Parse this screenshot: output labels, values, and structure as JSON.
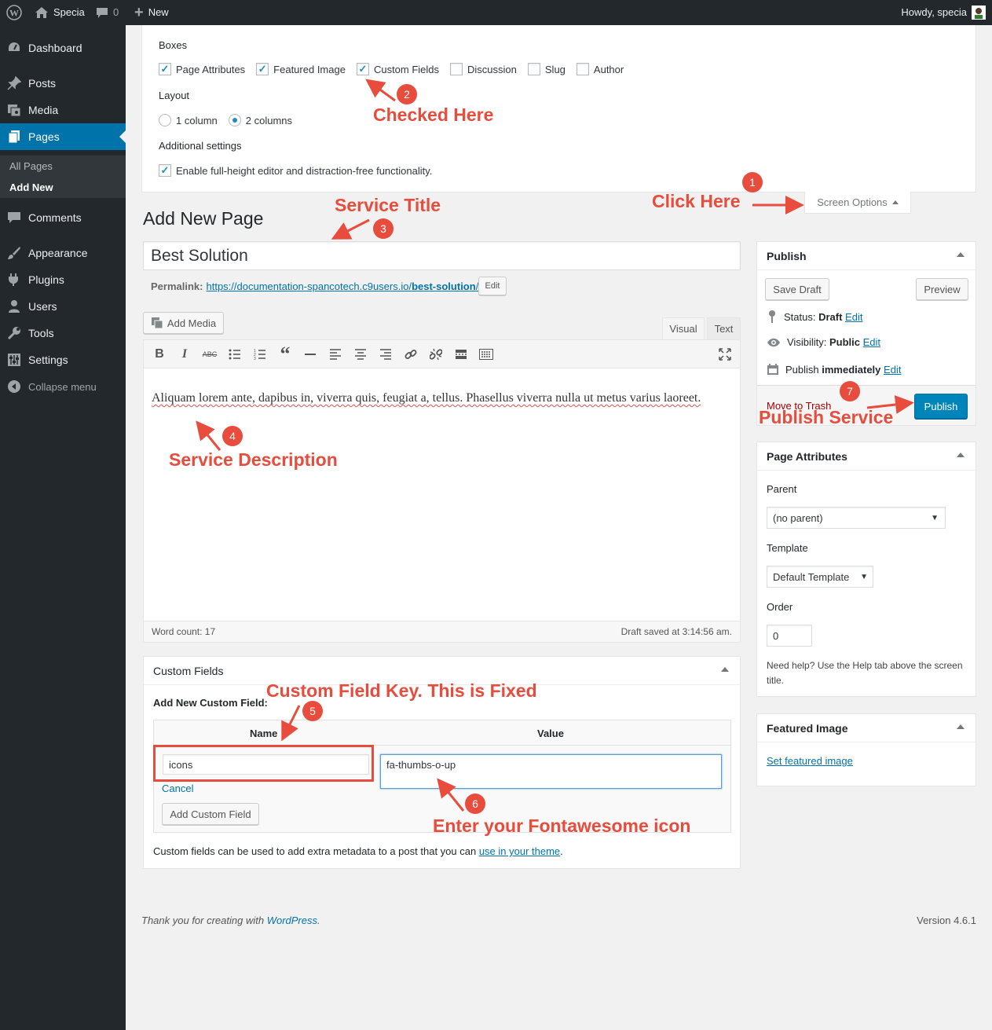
{
  "adminbar": {
    "site_name": "Specia",
    "comments_count": "0",
    "new_label": "New",
    "howdy": "Howdy, specia"
  },
  "sidebar": {
    "items": [
      {
        "label": "Dashboard"
      },
      {
        "label": "Posts"
      },
      {
        "label": "Media"
      },
      {
        "label": "Pages"
      },
      {
        "label": "Comments"
      },
      {
        "label": "Appearance"
      },
      {
        "label": "Plugins"
      },
      {
        "label": "Users"
      },
      {
        "label": "Tools"
      },
      {
        "label": "Settings"
      },
      {
        "label": "Collapse menu"
      }
    ],
    "submenu": [
      "All Pages",
      "Add New"
    ]
  },
  "screen_options": {
    "boxes_heading": "Boxes",
    "boxes": [
      {
        "label": "Page Attributes",
        "checked": true
      },
      {
        "label": "Featured Image",
        "checked": true
      },
      {
        "label": "Custom Fields",
        "checked": true
      },
      {
        "label": "Discussion",
        "checked": false
      },
      {
        "label": "Slug",
        "checked": false
      },
      {
        "label": "Author",
        "checked": false
      }
    ],
    "layout_heading": "Layout",
    "layout_options": [
      {
        "label": "1 column",
        "selected": false
      },
      {
        "label": "2 columns",
        "selected": true
      }
    ],
    "additional_heading": "Additional settings",
    "additional_option": "Enable full-height editor and distraction-free functionality.",
    "tab_label": "Screen Options"
  },
  "page": {
    "heading": "Add New Page",
    "title_value": "Best Solution",
    "permalink_label": "Permalink:",
    "permalink_url_base": "https://documentation-spancotech.c9users.io/",
    "permalink_slug": "best-solution",
    "permalink_trail": "/",
    "edit_label": "Edit",
    "add_media": "Add Media",
    "tab_visual": "Visual",
    "tab_text": "Text",
    "content": "Aliquam lorem ante, dapibus in, viverra quis, feugiat a, tellus. Phasellus viverra nulla ut metus varius laoreet.",
    "word_count": "Word count: 17",
    "draft_saved": "Draft saved at 3:14:56 am."
  },
  "custom_fields": {
    "title": "Custom Fields",
    "add_new_label": "Add New Custom Field:",
    "col_name": "Name",
    "col_value": "Value",
    "name_value": "icons",
    "value_value": "fa-thumbs-o-up",
    "cancel": "Cancel",
    "add_button": "Add Custom Field",
    "help_text": "Custom fields can be used to add extra metadata to a post that you can ",
    "help_link": "use in your theme",
    "help_end": "."
  },
  "publish": {
    "title": "Publish",
    "save_draft": "Save Draft",
    "preview": "Preview",
    "status_label": "Status: ",
    "status_value": "Draft",
    "visibility_label": "Visibility: ",
    "visibility_value": "Public",
    "publish_label": "Publish ",
    "publish_value": "immediately",
    "edit": "Edit",
    "trash": "Move to Trash",
    "publish_button": "Publish"
  },
  "page_attributes": {
    "title": "Page Attributes",
    "parent_label": "Parent",
    "parent_value": "(no parent)",
    "template_label": "Template",
    "template_value": "Default Template",
    "order_label": "Order",
    "order_value": "0",
    "help": "Need help? Use the Help tab above the screen title."
  },
  "featured_image": {
    "title": "Featured Image",
    "link": "Set featured image"
  },
  "footer": {
    "thanks": "Thank you for creating with ",
    "wp_link": "WordPress",
    "thanks_end": ".",
    "version": "Version 4.6.1"
  },
  "annotations": {
    "n1": "1",
    "t1": "Click Here",
    "n2": "2",
    "t2": "Checked Here",
    "n3": "3",
    "t3": "Service Title",
    "n4": "4",
    "t4": "Service Description",
    "n5": "5",
    "t5": "Custom Field Key. This is Fixed",
    "n6": "6",
    "t6": "Enter your Fontawesome icon",
    "n7": "7",
    "t7": "Publish Service",
    "color": "#e74c3c"
  },
  "colors": {
    "sidebar": "#23282d",
    "accent": "#0073aa",
    "primary_button": "#0085ba",
    "annotation": "#e74c3c"
  }
}
